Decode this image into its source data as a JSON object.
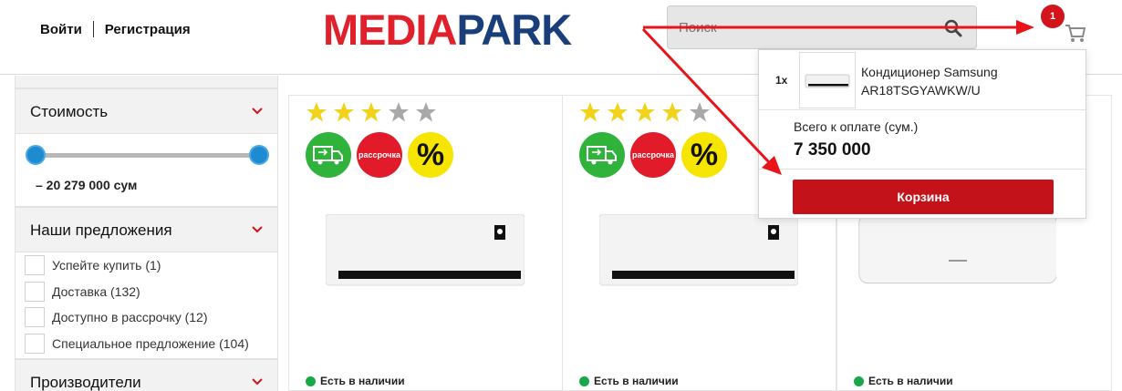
{
  "header": {
    "login": "Войти",
    "register": "Регистрация",
    "logo_part1": "MEDIA",
    "logo_part2": "PARK",
    "search_placeholder": "Поиск",
    "cart_count": "1"
  },
  "sidebar": {
    "price_title": "Стоимость",
    "price_range": "– 20 279 000 сум",
    "offers_title": "Наши предложения",
    "offers": [
      "Успейте купить (1)",
      "Доставка (132)",
      "Доступно в рассрочку (12)",
      "Специальное предложение (104)"
    ],
    "brands_title": "Производители"
  },
  "products": [
    {
      "rating": 3,
      "stock": "Есть в наличии"
    },
    {
      "rating": 4,
      "stock": "Есть в наличии"
    },
    {
      "rating": 0,
      "stock": "Есть в наличии"
    }
  ],
  "badges": {
    "installment": "рассрочка",
    "discount": "%"
  },
  "cart_popup": {
    "qty": "1x",
    "item_name": "Кондиционер Samsung AR18TSGYAWKW/U",
    "total_label": "Всего к оплате (сум.)",
    "total_value": "7 350 000",
    "button": "Корзина"
  },
  "colors": {
    "brand_red": "#e0212b",
    "brand_blue": "#1a3e7a",
    "arrow": "#e8141a",
    "button": "#c4121b"
  }
}
